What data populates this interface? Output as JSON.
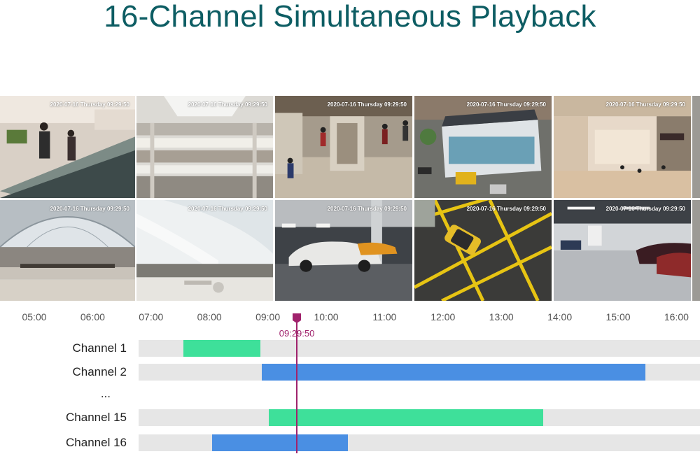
{
  "title": "16-Channel Simultaneous Playback",
  "camera_tiles": [
    {
      "timestamp": "2020-07-16 Thursday 09:29:50",
      "scene": "escalator-shoppers",
      "selected": false
    },
    {
      "timestamp": "2020-07-16 Thursday 09:29:50",
      "scene": "mall-atrium",
      "selected": false
    },
    {
      "timestamp": "2020-07-16 Thursday 09:29:50",
      "scene": "museum-hall",
      "selected": false
    },
    {
      "timestamp": "2020-07-16 Thursday 09:29:50",
      "scene": "aerial-shop",
      "selected": false
    },
    {
      "timestamp": "2020-07-16 Thursday 09:29:50",
      "scene": "mall-corridor",
      "selected": false
    },
    {
      "timestamp": "2020-07-16 Thursday 09:29:50",
      "scene": "glass-dome-mall",
      "selected": false
    },
    {
      "timestamp": "2020-07-16 Thursday 09:29:50",
      "scene": "white-atrium",
      "selected": false
    },
    {
      "timestamp": "2020-07-16 Thursday 09:29:50",
      "scene": "parking-garage-car",
      "selected": true
    },
    {
      "timestamp": "2020-07-16 Thursday 09:29:50",
      "scene": "parking-lot-aerial",
      "selected": false
    },
    {
      "timestamp": "2020-07-16 Thursday 09:29:50",
      "scene": "underground-parking",
      "selected": false
    }
  ],
  "timeline": {
    "ticks": [
      "05:00",
      "06:00",
      "07:00",
      "08:00",
      "09:00",
      "10:00",
      "11:00",
      "12:00",
      "13:00",
      "14:00",
      "15:00",
      "16:00"
    ],
    "playhead_time": "09:29:50",
    "playhead_hour": 9.497,
    "ellipsis": "...",
    "colors": {
      "green": "#3ee09a",
      "blue": "#4a8fe3",
      "track": "#e6e6e6",
      "playhead": "#a0226c"
    },
    "channels": [
      {
        "label": "Channel 1",
        "start_hour": 7.55,
        "end_hour": 8.87,
        "color": "green"
      },
      {
        "label": "Channel 2",
        "start_hour": 8.9,
        "end_hour": 15.47,
        "color": "blue"
      },
      {
        "label": "Channel 15",
        "start_hour": 9.02,
        "end_hour": 13.72,
        "color": "green"
      },
      {
        "label": "Channel 16",
        "start_hour": 8.05,
        "end_hour": 10.37,
        "color": "blue"
      }
    ]
  }
}
